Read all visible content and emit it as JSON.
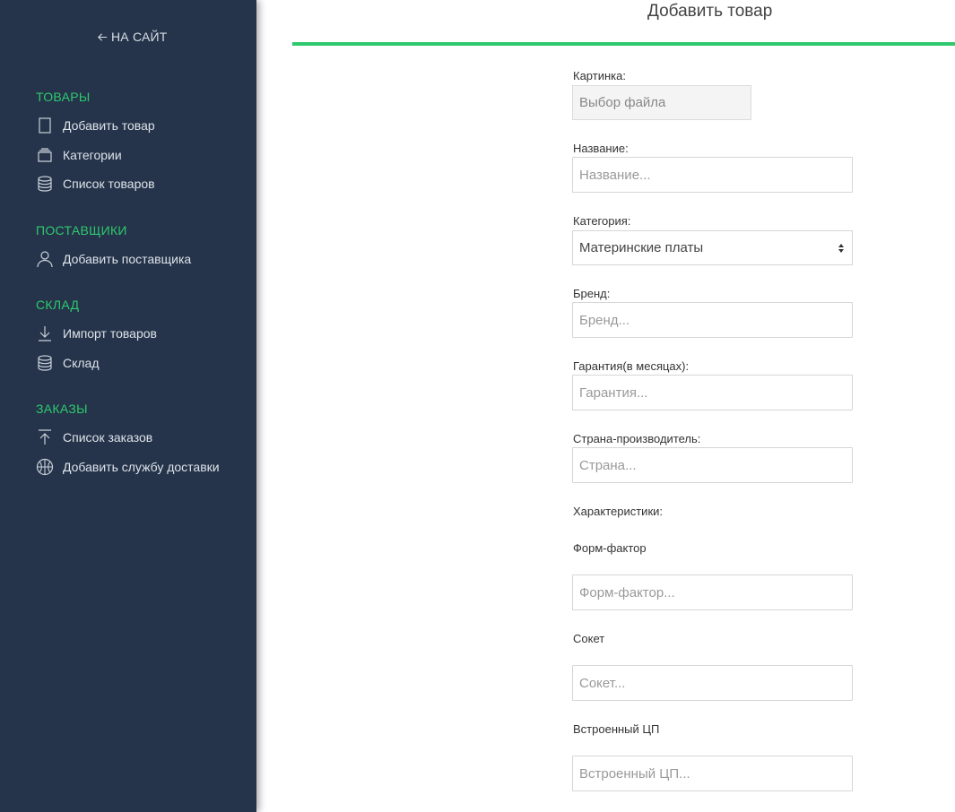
{
  "sidebar": {
    "back_label": "НА САЙТ",
    "sections": [
      {
        "title": "ТОВАРЫ",
        "items": [
          {
            "label": "Добавить товар",
            "icon": "tablet-icon"
          },
          {
            "label": "Категории",
            "icon": "stack-icon"
          },
          {
            "label": "Список товаров",
            "icon": "database-icon"
          }
        ]
      },
      {
        "title": "ПОСТАВЩИКИ",
        "items": [
          {
            "label": "Добавить поставщика",
            "icon": "user-icon"
          }
        ]
      },
      {
        "title": "СКЛАД",
        "items": [
          {
            "label": "Импорт товаров",
            "icon": "download-icon"
          },
          {
            "label": "Склад",
            "icon": "database-icon"
          }
        ]
      },
      {
        "title": "ЗАКАЗЫ",
        "items": [
          {
            "label": "Список заказов",
            "icon": "upload-icon"
          },
          {
            "label": "Добавить службу доставки",
            "icon": "basketball-icon"
          }
        ]
      }
    ]
  },
  "main": {
    "title": "Добавить товар",
    "accent_color": "#2ec96e",
    "form": {
      "image_label": "Картинка:",
      "file_button": "Выбор файла",
      "name_label": "Название:",
      "name_placeholder": "Название...",
      "category_label": "Категория:",
      "category_value": "Материнские платы",
      "brand_label": "Бренд:",
      "brand_placeholder": "Бренд...",
      "warranty_label": "Гарантия(в месяцах):",
      "warranty_placeholder": "Гарантия...",
      "country_label": "Страна-производитель:",
      "country_placeholder": "Страна...",
      "specs_label": "Характеристики:",
      "form_factor_label": "Форм-фактор",
      "form_factor_placeholder": "Форм-фактор...",
      "socket_label": "Сокет",
      "socket_placeholder": "Сокет...",
      "cpu_label": "Встроенный ЦП",
      "cpu_placeholder": "Встроенный ЦП..."
    }
  }
}
